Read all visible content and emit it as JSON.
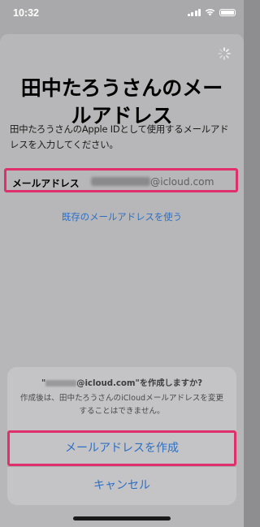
{
  "status_bar": {
    "time": "10:32"
  },
  "page": {
    "title": "田中たろうさんのメールアドレス",
    "description": "田中たろうさんのApple IDとして使用するメールアドレスを入力してください。",
    "email_label": "メールアドレス",
    "email_domain": "@icloud.com",
    "existing_link": "既存のメールアドレスを使う"
  },
  "alert": {
    "title_prefix": "\"",
    "title_suffix": "@icloud.com\"を作成しますか?",
    "message": "作成後は、田中たろうさんのiCloudメールアドレスを変更することはできません。",
    "create_label": "メールアドレスを作成",
    "cancel_label": "キャンセル"
  },
  "colors": {
    "accent": "#2e6fc4",
    "highlight": "#e0306b"
  }
}
